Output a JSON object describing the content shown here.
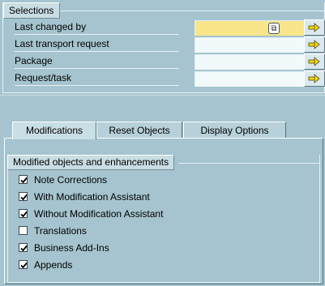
{
  "selections": {
    "title": "Selections",
    "rows": [
      {
        "label": "Last changed by",
        "value": "",
        "required": true
      },
      {
        "label": "Last transport request",
        "value": ""
      },
      {
        "label": "Package",
        "value": ""
      },
      {
        "label": "Request/task",
        "value": ""
      }
    ],
    "matchcode_icon": "matchcode-icon",
    "arrow_icon": "multiple-selection-arrow-icon"
  },
  "tabs": [
    {
      "label": "Modifications",
      "active": true
    },
    {
      "label": "Reset Objects",
      "active": false
    },
    {
      "label": "Display Options",
      "active": false
    }
  ],
  "modified_group": {
    "title": "Modified objects and enhancements",
    "items": [
      {
        "label": "Note Corrections",
        "checked": true
      },
      {
        "label": "With Modification Assistant",
        "checked": true
      },
      {
        "label": "Without Modification Assistant",
        "checked": true
      },
      {
        "label": "Translations",
        "checked": false
      },
      {
        "label": "Business Add-Ins",
        "checked": true
      },
      {
        "label": "Appends",
        "checked": true
      }
    ]
  },
  "colors": {
    "background": "#a5c4cf",
    "required_field": "#f9e58a",
    "input_field": "#f2f9fb"
  }
}
